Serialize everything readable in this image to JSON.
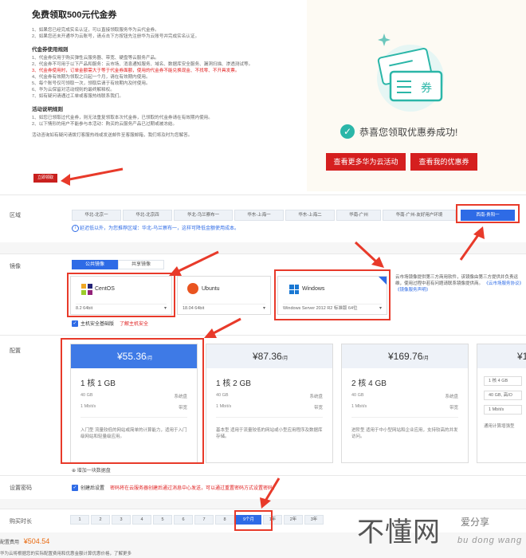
{
  "rules": {
    "title": "免费领取500元代金券",
    "intro": [
      "1、如果您已经完成实名认证，可以直接领取服务华为云代金券。",
      "2、如果您还未开通华为云账号，请点击下方按钮先注册华为云账号并完成实名认证。"
    ],
    "usage_heading": "代金券使用规则",
    "usage": [
      "1、代金券仅用于购买弹性云服务器、带宽、硬盘等云服务产品。",
      "2、代金券不可用于以下产品和服务：云市场、消息通知服务、域名、数据库安全服务、漏洞扫描、渗透测试等。",
      "3、代金券使用时，订单金额需大于等于代金券面额，使用的代金券不能兑换现金、不找零、不开具发票。",
      "4、代金券有效期为领取之日起一个月，请在有效期内使用。",
      "5、每个账号仅可领取一次，领取后请于有效期内及时使用。",
      "6、华为云保留对活动规则的最终解释权。",
      "7、如有疑问请通过工单或客服热线联系我们。"
    ],
    "rules_heading": "活动说明规则",
    "rules_text": [
      "1、如您已领取过代金券，则无法重复领取本次代金券，已领取的代金券请在有效期内使用。",
      "2、以下情形的用户不能参与本活动：购买的云服务产品已过期或被冻结。"
    ],
    "contact": "活动咨询如有疑问请拨打客服热线或发送邮件至客服邮箱，我们将及时为您解答。",
    "claim_button": "立即领取"
  },
  "success": {
    "ticket_label": "券",
    "message": "恭喜您领取优惠券成功!",
    "button_left": "查看更多华为云活动",
    "button_right": "查看我的优惠券"
  },
  "config": {
    "region_label": "区域",
    "regions": [
      "华北-北京一",
      "华北-北京四",
      "华北-乌兰察布一",
      "华东-上海一",
      "华东-上海二",
      "华南-广州",
      "华南-广州-友好用户环境",
      "西南-贵阳一"
    ],
    "region_notice": "延迟低以外，为您推荐区域：华北-乌兰察布一，这样可降低金额使用成本。",
    "image_label": "镜像",
    "image_tabs": [
      "公共镜像",
      "共享镜像"
    ],
    "os": [
      {
        "name": "CentOS",
        "version": "8.2 64bit"
      },
      {
        "name": "Ubuntu",
        "version": "18.04 64bit"
      },
      {
        "name": "Windows",
        "version": "Windows Server 2012 R2 标准版 64位"
      }
    ],
    "image_tip": "云市场镜像提供第三方商用软件，该镜像由第三方提供并负责运维，使用过程中若有问题请联系镜像提供商。",
    "image_tip_links": "《云市场服务协议》 《镜像服务声明》",
    "host_security": "主机安全基础版",
    "host_security_link": "了解主机安全",
    "spec_label": "配置",
    "plans": [
      {
        "price": "¥55.36",
        "unit": "/月",
        "spec": "1 核 1 GB",
        "disk": "40 GB",
        "disk_type": "系统盘",
        "bw": "1 Mbit/s",
        "bw_type": "带宽",
        "desc": "入门型 流量较低的网站或简单的计算能力，适用于入门级网站和轻量级应用。"
      },
      {
        "price": "¥87.36",
        "unit": "/月",
        "spec": "1 核 2 GB",
        "disk": "40 GB",
        "disk_type": "系统盘",
        "bw": "1 Mbit/s",
        "bw_type": "带宽",
        "desc": "基本型 适用于流量较低的网站或小型应用程序及数据库存储。"
      },
      {
        "price": "¥169.76",
        "unit": "/月",
        "spec": "2 核 4 GB",
        "disk": "40 GB",
        "disk_type": "系统盘",
        "bw": "1 Mbit/s",
        "bw_type": "带宽",
        "desc": "进阶型 适用于中小型网站和企业应用，支持较高的并发访问。"
      },
      {
        "price": "¥1",
        "unit": "",
        "spec": "",
        "options": [
          "1 核 4 GB",
          "40 GB, 高IO",
          "1 Mbit/s"
        ],
        "desc": "通用计算增强型"
      }
    ],
    "add_disk": "增加一块数据盘",
    "login_label": "设置密码",
    "login_text": "创建后设置",
    "login_note": "密码将在云服务器创建后通过消息中心发送，可以通过重置密码方式设置密码。",
    "duration_label": "购买时长",
    "durations": [
      "1",
      "2",
      "3",
      "4",
      "5",
      "6",
      "7",
      "8",
      "9个月",
      "1年",
      "2年",
      "3年"
    ],
    "selected_duration": "9个月",
    "fee_label": "配置费用",
    "fee": "¥504.54",
    "fee_note": "华为云将根据您的实际配置费用和优惠金额计算优惠价格，了解更多"
  },
  "watermark": {
    "cn": "不懂网",
    "sub": "爱分享",
    "pinyin": "bu dong wang"
  },
  "colors": {
    "primary": "#2e6be6",
    "red": "#d51f1f",
    "annotation": "#e83a2a",
    "teal": "#2bb6a8"
  }
}
